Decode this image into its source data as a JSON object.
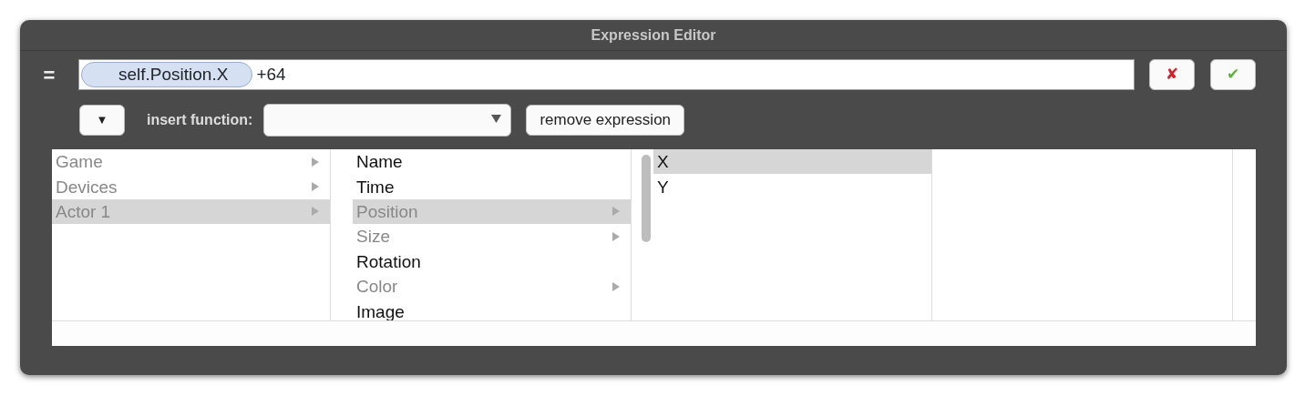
{
  "window": {
    "title": "Expression Editor"
  },
  "expression": {
    "prefix": "=",
    "token": "self.Position.X",
    "text": "+64"
  },
  "buttons": {
    "cancel": "✘",
    "accept": "✔",
    "menu": "▼",
    "remove": "remove expression"
  },
  "insert_function": {
    "label": "insert function:"
  },
  "browser_columns": [
    {
      "items": [
        {
          "label": "Game",
          "expandable": true,
          "selected": false
        },
        {
          "label": "Devices",
          "expandable": true,
          "selected": false
        },
        {
          "label": "Actor 1",
          "expandable": true,
          "selected": true
        }
      ]
    },
    {
      "scrollbar": true,
      "items": [
        {
          "label": "Name",
          "expandable": false,
          "selected": false
        },
        {
          "label": "Time",
          "expandable": false,
          "selected": false
        },
        {
          "label": "Position",
          "expandable": true,
          "selected": true
        },
        {
          "label": "Size",
          "expandable": true,
          "selected": false
        },
        {
          "label": "Rotation",
          "expandable": false,
          "selected": false
        },
        {
          "label": "Color",
          "expandable": true,
          "selected": false
        },
        {
          "label": "Image",
          "expandable": false,
          "selected": false
        }
      ]
    },
    {
      "items": [
        {
          "label": "X",
          "expandable": false,
          "selected": true
        },
        {
          "label": "Y",
          "expandable": false,
          "selected": false
        }
      ]
    },
    {
      "scrollbar": false
    }
  ]
}
